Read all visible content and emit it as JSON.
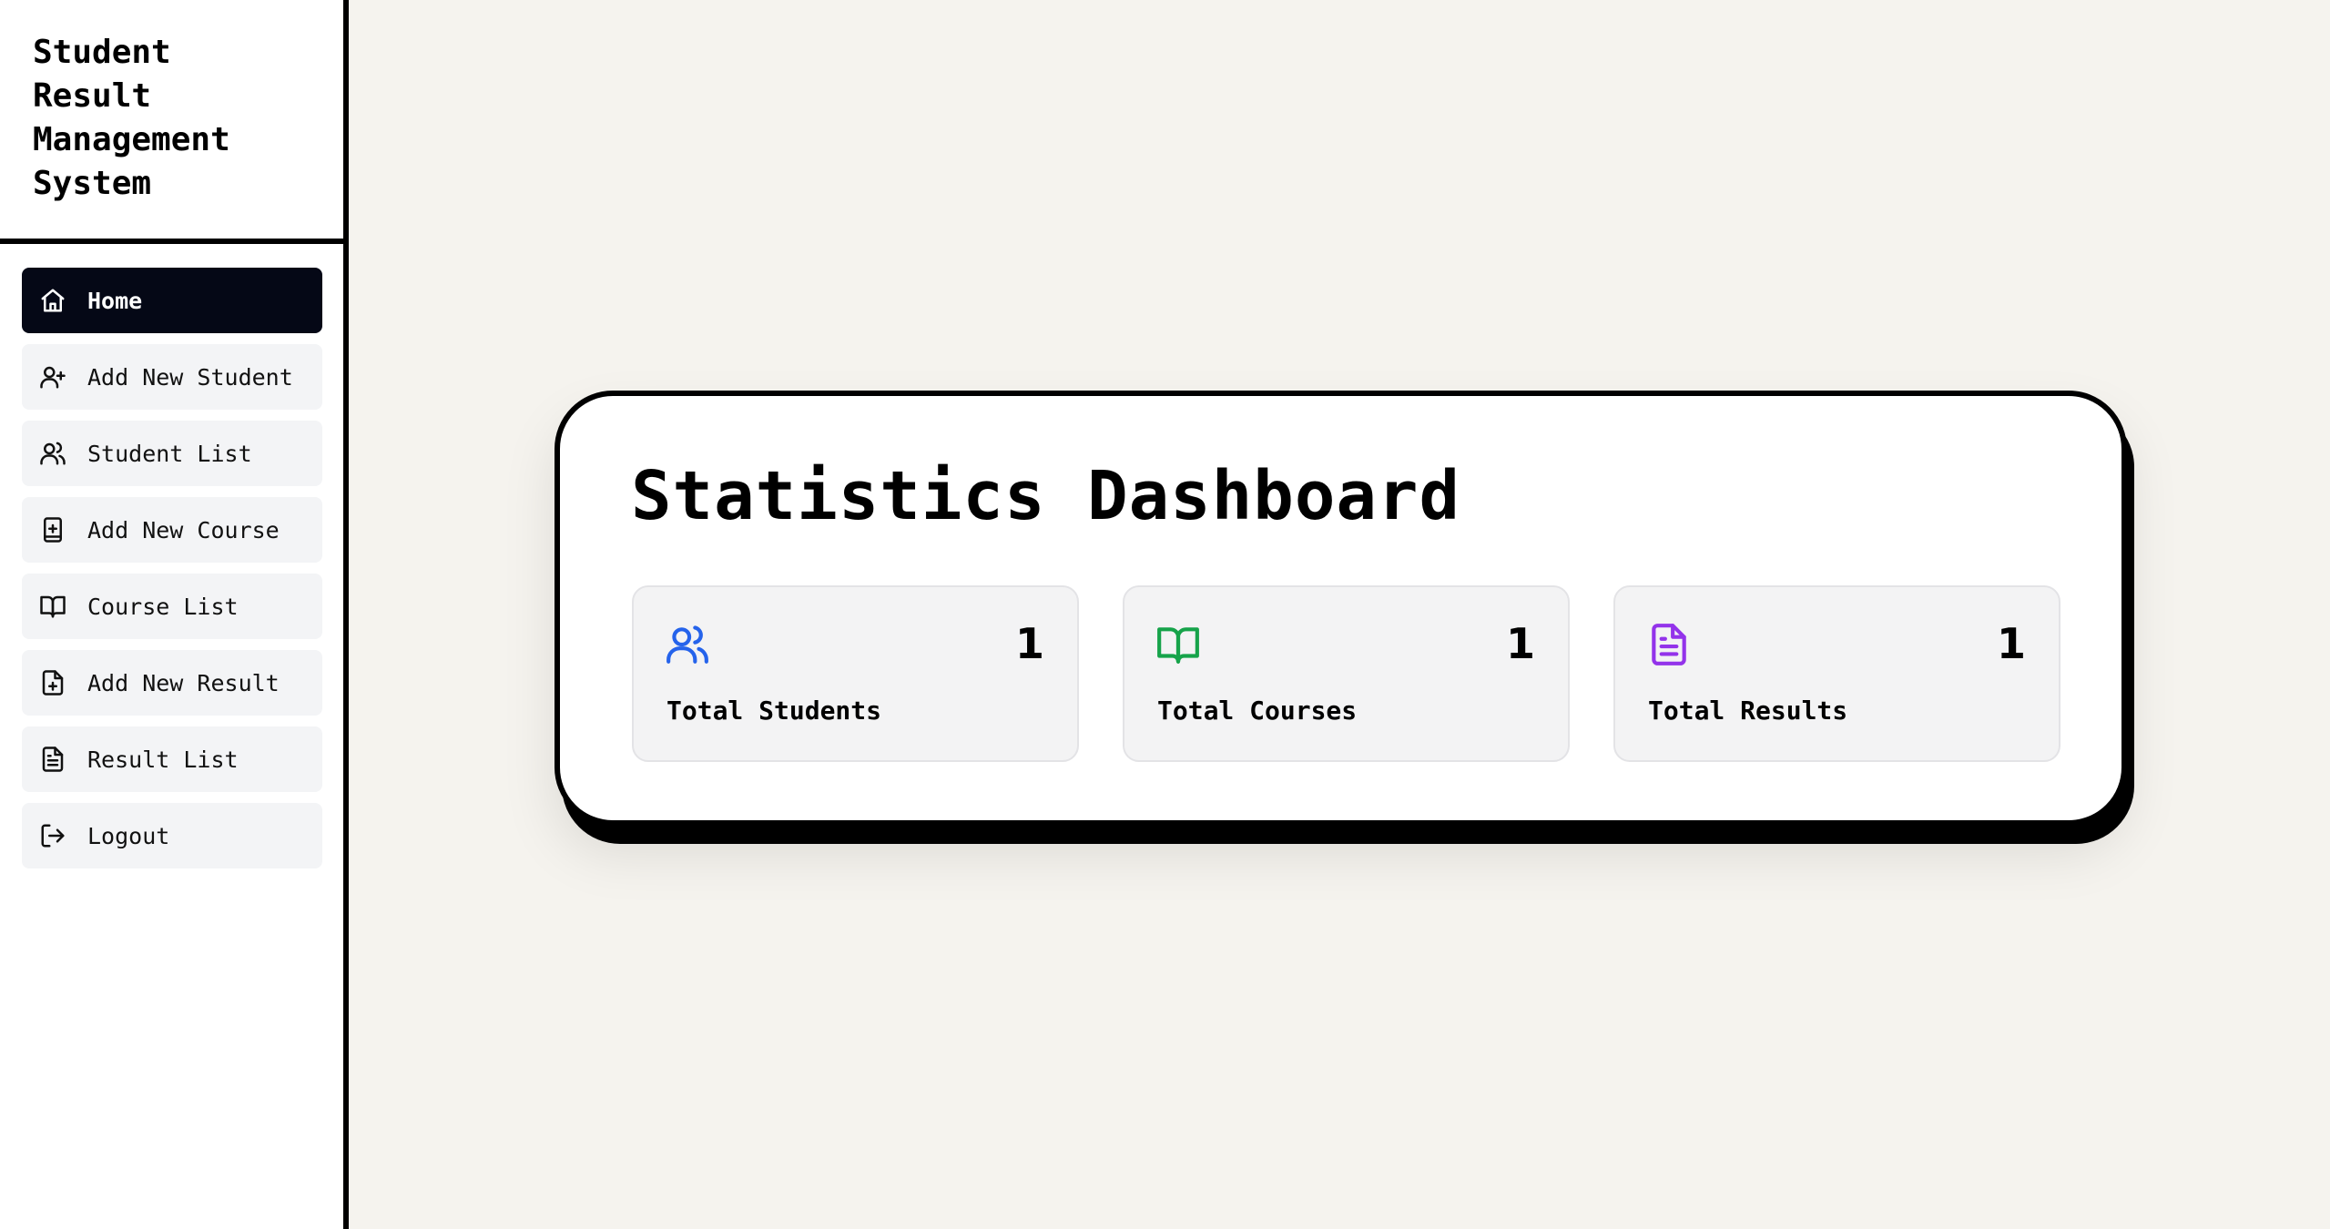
{
  "app": {
    "title": "Student Result Management System"
  },
  "sidebar": {
    "items": [
      {
        "label": "Home",
        "icon": "home-icon",
        "active": true
      },
      {
        "label": "Add New Student",
        "icon": "user-plus-icon",
        "active": false
      },
      {
        "label": "Student List",
        "icon": "users-icon",
        "active": false
      },
      {
        "label": "Add New Course",
        "icon": "book-plus-icon",
        "active": false
      },
      {
        "label": "Course List",
        "icon": "book-open-icon",
        "active": false
      },
      {
        "label": "Add New Result",
        "icon": "file-plus-icon",
        "active": false
      },
      {
        "label": "Result List",
        "icon": "file-text-icon",
        "active": false
      },
      {
        "label": "Logout",
        "icon": "logout-icon",
        "active": false
      }
    ]
  },
  "dashboard": {
    "title": "Statistics Dashboard",
    "stats": [
      {
        "label": "Total Students",
        "value": "1",
        "icon": "users-icon",
        "color": "#2563eb"
      },
      {
        "label": "Total Courses",
        "value": "1",
        "icon": "book-open-icon",
        "color": "#16a34a"
      },
      {
        "label": "Total Results",
        "value": "1",
        "icon": "file-text-icon",
        "color": "#9333ea"
      }
    ]
  },
  "colors": {
    "background": "#f5f3ee",
    "active_nav": "#050816",
    "nav_item": "#f3f4f6",
    "card": "#ffffff"
  }
}
